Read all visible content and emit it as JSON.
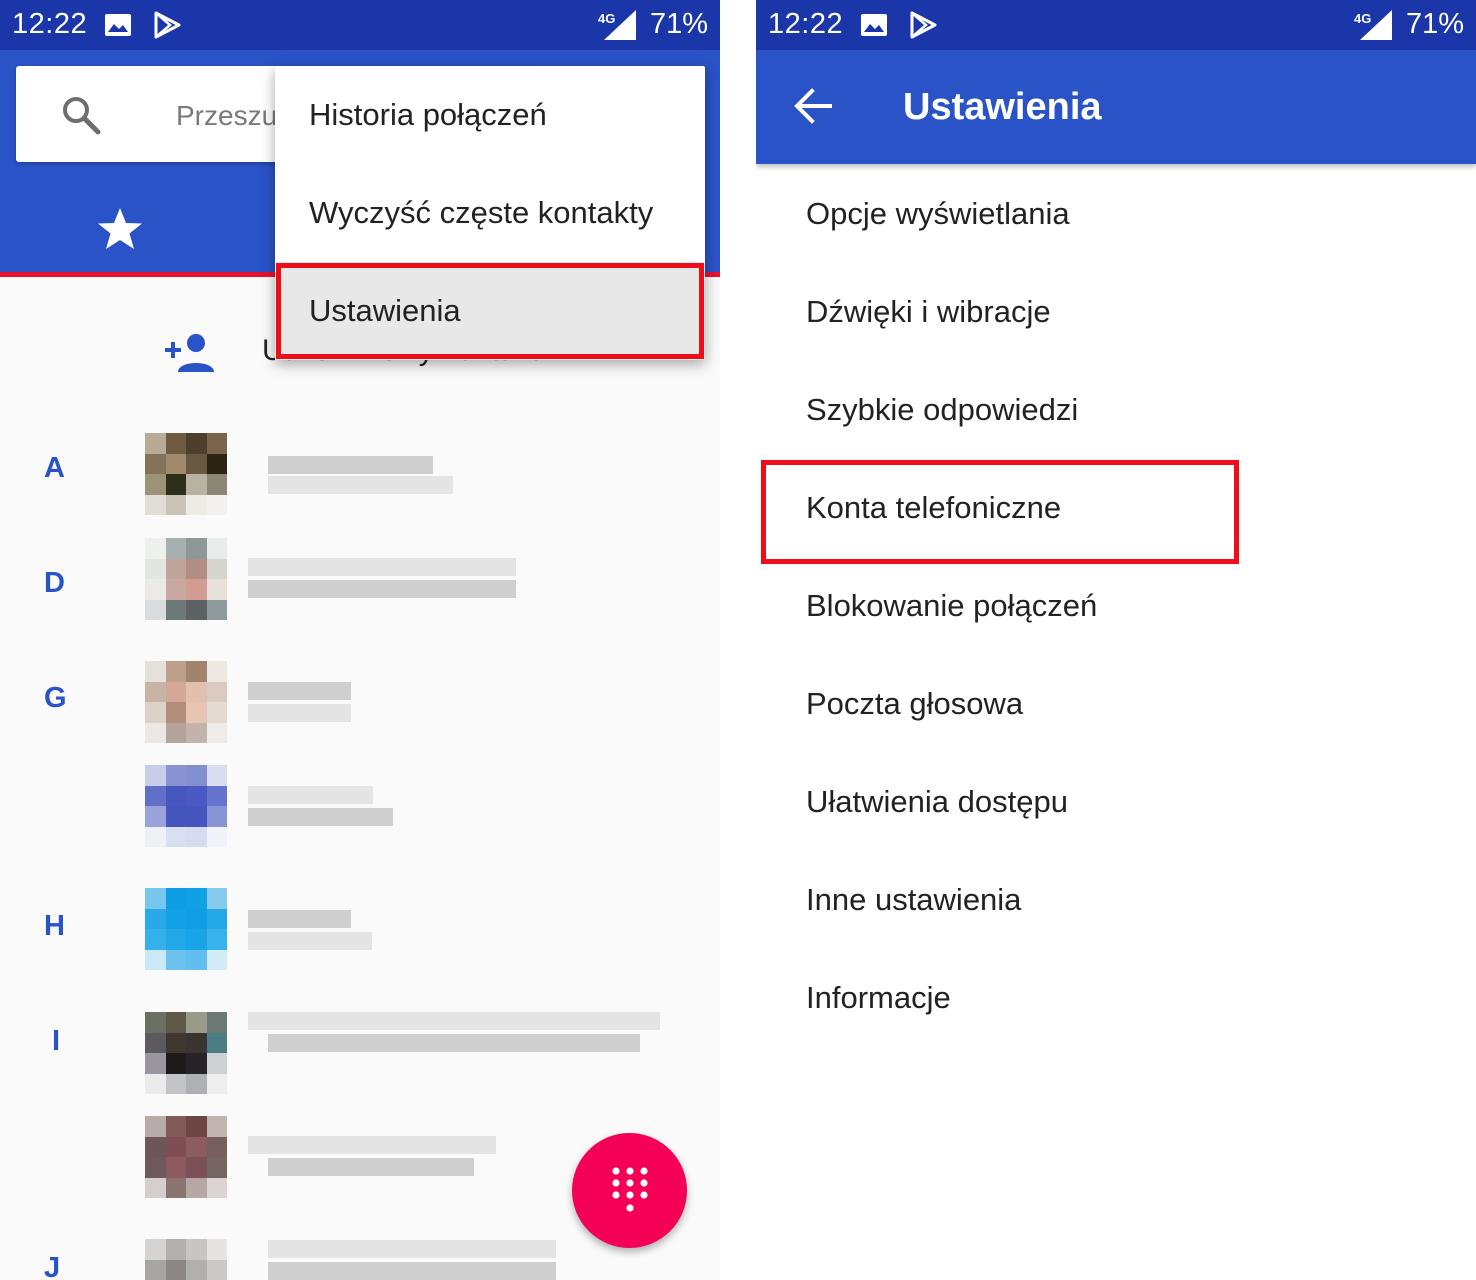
{
  "status_bar": {
    "time": "12:22",
    "network": "4G",
    "battery": "71%"
  },
  "left": {
    "search_placeholder": "Przeszu",
    "create_contact": "Utwórz nowy kontakt",
    "menu": {
      "items": [
        "Historia połączeń",
        "Wyczyść częste kontakty",
        "Ustawienia"
      ],
      "highlighted": "Ustawienia"
    },
    "section_letters": [
      "A",
      "D",
      "G",
      "H",
      "I",
      "J"
    ],
    "fab_icon": "dialpad-icon"
  },
  "right": {
    "title": "Ustawienia",
    "items": [
      "Opcje wyświetlania",
      "Dźwięki i wibracje",
      "Szybkie odpowiedzi",
      "Konta telefoniczne",
      "Blokowanie połączeń",
      "Poczta głosowa",
      "Ułatwienia dostępu",
      "Inne ustawienia",
      "Informacje"
    ],
    "highlighted": "Konta telefoniczne"
  },
  "colors": {
    "status_bar": "#1b36a8",
    "primary": "#2b53c8",
    "accent": "#f50057",
    "highlight_box": "#ee0e1a"
  }
}
